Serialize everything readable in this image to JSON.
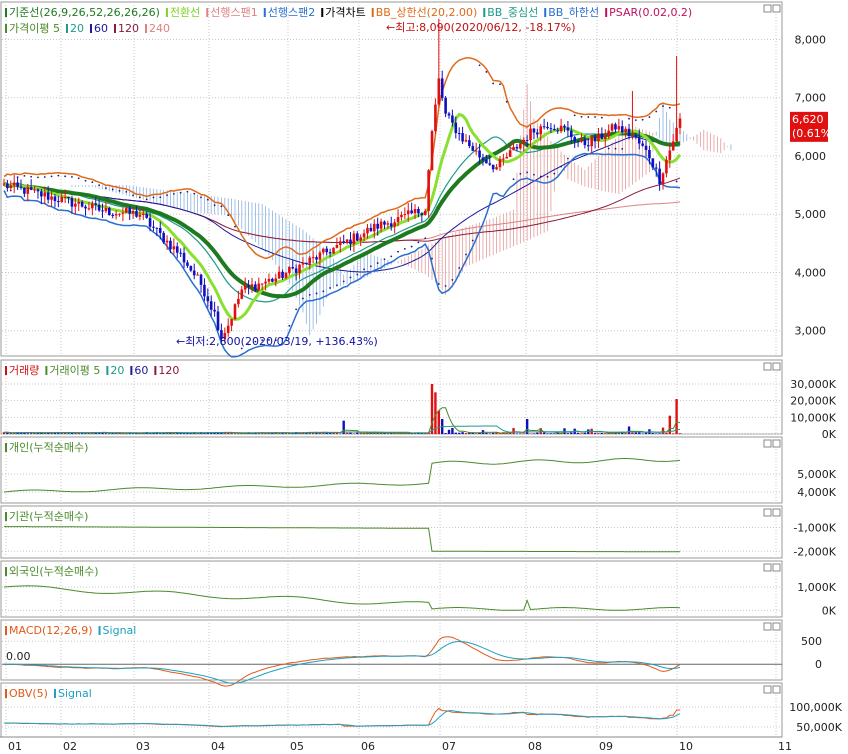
{
  "panels": [
    {
      "id": "price",
      "legend_rows": [
        [
          {
            "text": "기준선(26,9,26,52,26,26,26)",
            "color": "#1e7a1e"
          },
          {
            "text": "전환선",
            "color": "#7dd321"
          },
          {
            "text": "선행스팬1",
            "color": "#e08080"
          },
          {
            "text": "선행스팬2",
            "color": "#2a6fd0"
          },
          {
            "text": "가격차트",
            "color": "#000000"
          },
          {
            "text": "BB_상한선(20,2.00)",
            "color": "#e06a1a"
          },
          {
            "text": "BB_중심선",
            "color": "#1f9a8a"
          },
          {
            "text": "BB_하한선",
            "color": "#2a6fd0"
          },
          {
            "text": "PSAR(0.02,0.2)",
            "color": "#c01060"
          }
        ],
        [
          {
            "text": "가격이평 5",
            "color": "#4a8a2a"
          },
          {
            "text": "20",
            "color": "#1f9a8a"
          },
          {
            "text": "60",
            "color": "#1a1a9a"
          },
          {
            "text": "120",
            "color": "#8a1a3a"
          },
          {
            "text": "240",
            "color": "#e08080"
          }
        ]
      ],
      "y_ticks": [
        "8,000",
        "7,000",
        "6,000",
        "5,000",
        "4,000",
        "3,000"
      ],
      "current_price": "6,620",
      "current_change": "(0.61%)",
      "annotation_high": "←최고:8,090(2020/06/12, -18.17%)",
      "annotation_low": "←최저:2,800(2020/03/19, +136.43%)"
    },
    {
      "id": "volume",
      "legend_rows": [
        [
          {
            "text": "거래량",
            "color": "#d01010"
          },
          {
            "text": "거래이평 5",
            "color": "#4a8a2a"
          },
          {
            "text": "20",
            "color": "#1f9a8a"
          },
          {
            "text": "60",
            "color": "#1a1a9a"
          },
          {
            "text": "120",
            "color": "#8a1a3a"
          }
        ]
      ],
      "y_ticks": [
        "30,000K",
        "20,000K",
        "10,000K",
        "0K"
      ]
    },
    {
      "id": "individual",
      "legend_rows": [
        [
          {
            "text": "개인(누적순매수)",
            "color": "#4a8a2a"
          }
        ]
      ],
      "y_ticks": [
        "5,000K",
        "4,000K"
      ]
    },
    {
      "id": "institution",
      "legend_rows": [
        [
          {
            "text": "기관(누적순매수)",
            "color": "#4a8a2a"
          }
        ]
      ],
      "y_ticks": [
        "-1,000K",
        "-2,000K"
      ]
    },
    {
      "id": "foreign",
      "legend_rows": [
        [
          {
            "text": "외국인(누적순매수)",
            "color": "#4a8a2a"
          }
        ]
      ],
      "y_ticks": [
        "1,000K",
        "0K"
      ]
    },
    {
      "id": "macd",
      "legend_rows": [
        [
          {
            "text": "MACD(12,26,9)",
            "color": "#e05a1a"
          },
          {
            "text": "Signal",
            "color": "#1fa0c0"
          }
        ]
      ],
      "y_ticks": [
        "500",
        "0"
      ],
      "level_label": "0.00"
    },
    {
      "id": "obv",
      "legend_rows": [
        [
          {
            "text": "OBV(5)",
            "color": "#e05a1a"
          },
          {
            "text": "Signal",
            "color": "#1fa0c0"
          }
        ]
      ],
      "y_ticks": [
        "100,000K",
        "50,000K"
      ]
    }
  ],
  "x_months": [
    "01",
    "02",
    "03",
    "04",
    "05",
    "06",
    "07",
    "08",
    "09",
    "10",
    "11"
  ],
  "colors": {
    "up": "#e01010",
    "down": "#1010c0",
    "grid": "#c8c8c8",
    "frame": "#9a9a9a"
  },
  "chart_data": {
    "type": "line",
    "x": [
      "2020-01",
      "2020-02",
      "2020-03",
      "2020-04",
      "2020-05",
      "2020-06",
      "2020-07",
      "2020-08",
      "2020-09",
      "2020-10"
    ],
    "series": [
      {
        "name": "가격차트",
        "values": [
          5500,
          5000,
          3000,
          4000,
          4800,
          7000,
          5900,
          6400,
          6300,
          6620
        ]
      },
      {
        "name": "거래량",
        "values": [
          500,
          400,
          2500,
          800,
          1200,
          30000,
          6000,
          9000,
          5000,
          20000
        ]
      },
      {
        "name": "개인(누적순매수)",
        "values": [
          4000,
          4300,
          4200,
          4200,
          4500,
          5600,
          5700,
          5800,
          5800,
          5800
        ]
      },
      {
        "name": "기관(누적순매수)",
        "values": [
          -1000,
          -1000,
          -1050,
          -1050,
          -1050,
          -2000,
          -2000,
          -2000,
          -2000,
          -2000
        ]
      },
      {
        "name": "외국인(누적순매수)",
        "values": [
          1000,
          800,
          600,
          400,
          300,
          0,
          0,
          100,
          100,
          0
        ]
      }
    ],
    "ylabel": "",
    "ylim": [
      2700,
      8200
    ]
  }
}
